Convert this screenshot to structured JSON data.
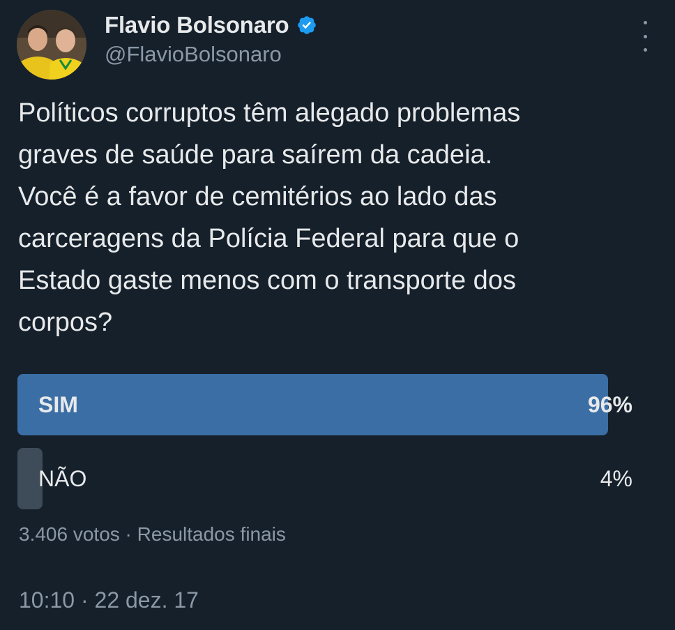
{
  "author": {
    "display_name": "Flavio Bolsonaro",
    "handle": "@FlavioBolsonaro",
    "verified": true,
    "avatar_icon": "profile-photo"
  },
  "tweet": {
    "text": "Políticos corruptos têm alegado problemas\ngraves de saúde para saírem da cadeia.\nVocê é a favor de cemitérios ao lado das\ncarceragens da Polícia Federal para que o\nEstado gaste menos com o transporte dos\ncorpos?"
  },
  "poll": {
    "options": [
      {
        "label": "SIM",
        "percent": "96%",
        "fraction": 0.96,
        "winner": true
      },
      {
        "label": "NÃO",
        "percent": "4%",
        "fraction": 0.04,
        "winner": false
      }
    ],
    "votes": "3.406 votos",
    "separator": " · ",
    "status": "Resultados finais"
  },
  "timestamp": "10:10 · 22 dez. 17",
  "colors": {
    "background": "#15202b",
    "verified_blue": "#1d9bf0",
    "winner_bar": "#3b6ea5",
    "loser_bar": "#3e4b58",
    "secondary_text": "#8b98a5"
  }
}
